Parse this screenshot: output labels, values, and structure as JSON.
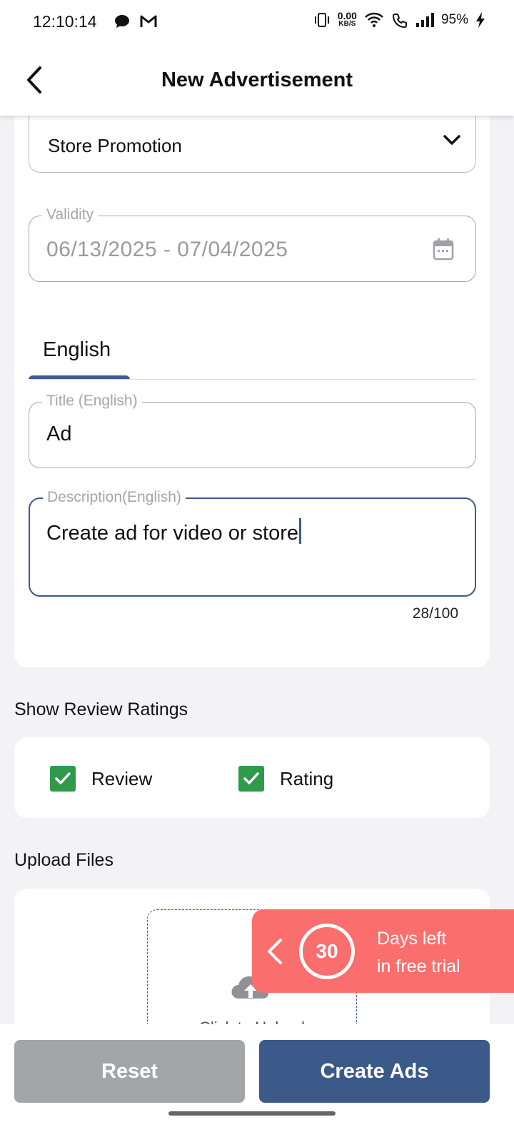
{
  "status_bar": {
    "time": "12:10:14",
    "net_speed_value": "0.00",
    "net_speed_unit": "KB/S",
    "battery": "95%"
  },
  "app_bar": {
    "title": "New Advertisement"
  },
  "form": {
    "ad_type_selected": "Store Promotion",
    "validity_label": "Validity",
    "validity_value": "06/13/2025 - 07/04/2025",
    "tabs": [
      {
        "label": "English",
        "active": true
      }
    ],
    "title_label": "Title (English)",
    "title_value": "Ad",
    "description_label": "Description(English)",
    "description_value": "Create ad for video or store",
    "description_counter": "28/100"
  },
  "review_ratings": {
    "heading": "Show Review Ratings",
    "options": [
      {
        "label": "Review",
        "checked": true
      },
      {
        "label": "Rating",
        "checked": true
      }
    ]
  },
  "upload": {
    "heading": "Upload Files",
    "zone_text": "Click to Upload"
  },
  "trial_banner": {
    "days": "30",
    "line1": "Days left",
    "line2": "in free trial"
  },
  "actions": {
    "reset_label": "Reset",
    "create_label": "Create Ads"
  },
  "colors": {
    "primary": "#3b5a8a",
    "checkbox": "#2e9a4a",
    "trial": "#fb6e6e",
    "disabled": "#a3a5a9"
  }
}
